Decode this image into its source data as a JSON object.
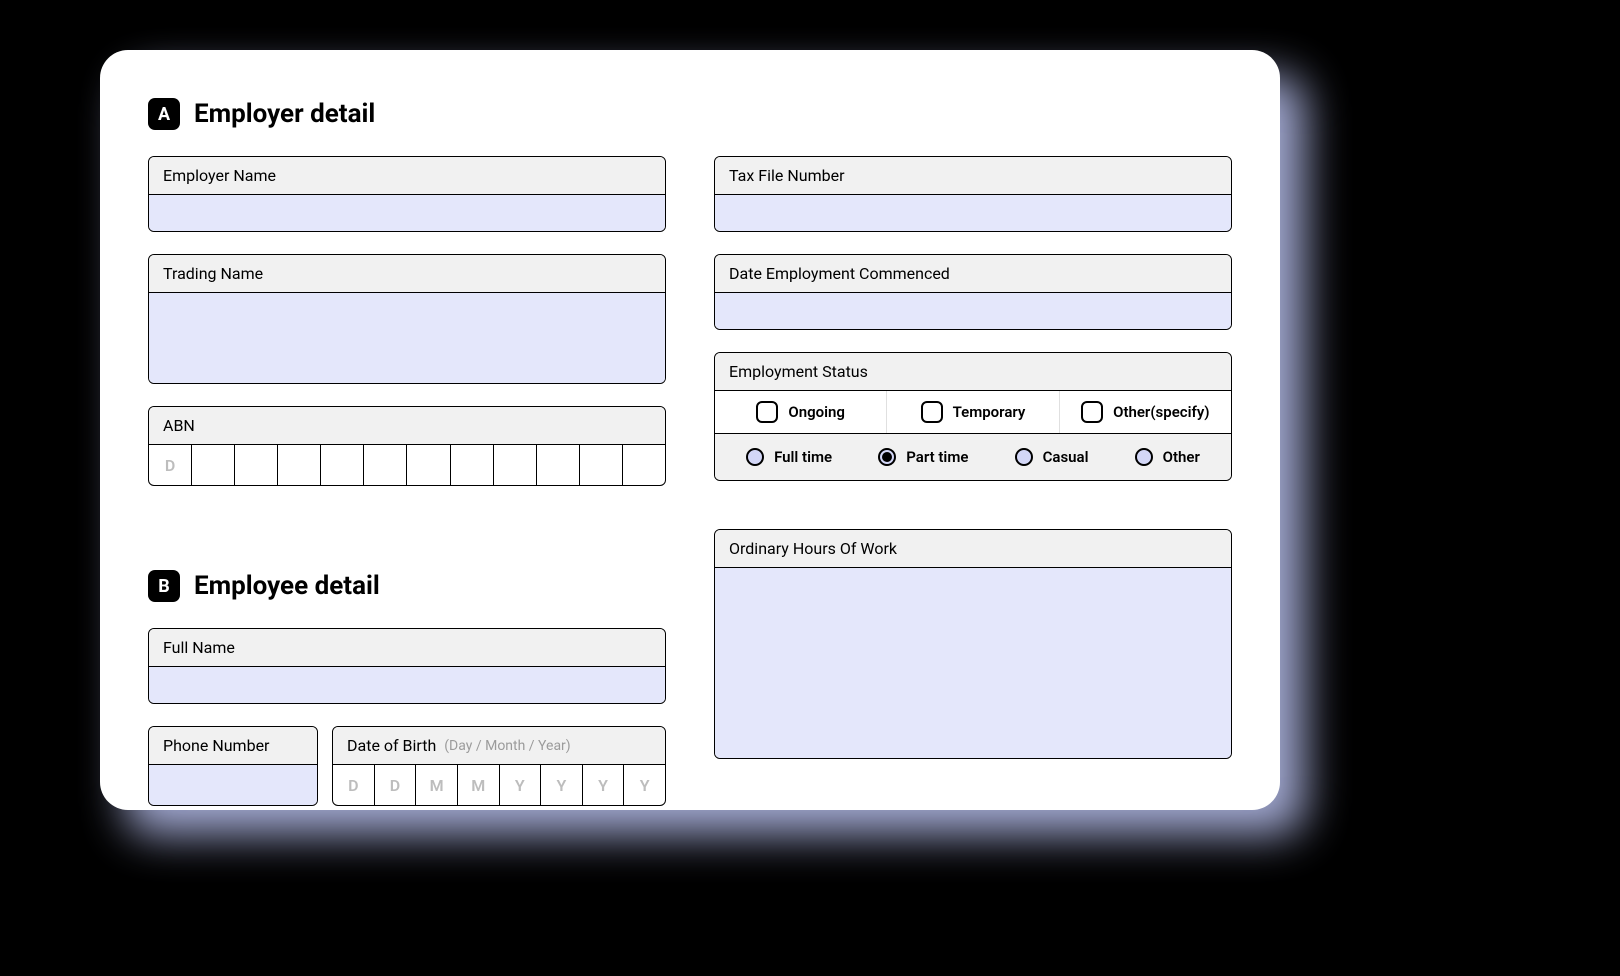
{
  "sectionA": {
    "badge": "A",
    "title": "Employer detail",
    "employerName": {
      "label": "Employer Name",
      "value": ""
    },
    "tradingName": {
      "label": "Trading Name",
      "value": ""
    },
    "abn": {
      "label": "ABN",
      "cells": [
        "D",
        "",
        "",
        "",
        "",
        "",
        "",
        "",
        "",
        "",
        "",
        ""
      ]
    }
  },
  "sectionB": {
    "badge": "B",
    "title": "Employee detail",
    "fullName": {
      "label": "Full Name",
      "value": ""
    },
    "phone": {
      "label": "Phone Number",
      "value": ""
    },
    "dob": {
      "label": "Date of Birth",
      "hint": "(Day / Month / Year)",
      "cells": [
        "D",
        "D",
        "M",
        "M",
        "Y",
        "Y",
        "Y",
        "Y"
      ]
    }
  },
  "right": {
    "tfn": {
      "label": "Tax File Number",
      "value": ""
    },
    "dateCommenced": {
      "label": "Date Employment Commenced",
      "value": ""
    },
    "employmentStatus": {
      "label": "Employment Status",
      "checks": [
        {
          "label": "Ongoing",
          "checked": false
        },
        {
          "label": "Temporary",
          "checked": false
        },
        {
          "label": "Other(specify)",
          "checked": false
        }
      ],
      "radios": [
        {
          "label": "Full time",
          "selected": false
        },
        {
          "label": "Part time",
          "selected": true
        },
        {
          "label": "Casual",
          "selected": false
        },
        {
          "label": "Other",
          "selected": false
        }
      ]
    },
    "ordinaryHours": {
      "label": "Ordinary Hours Of Work",
      "value": ""
    }
  }
}
